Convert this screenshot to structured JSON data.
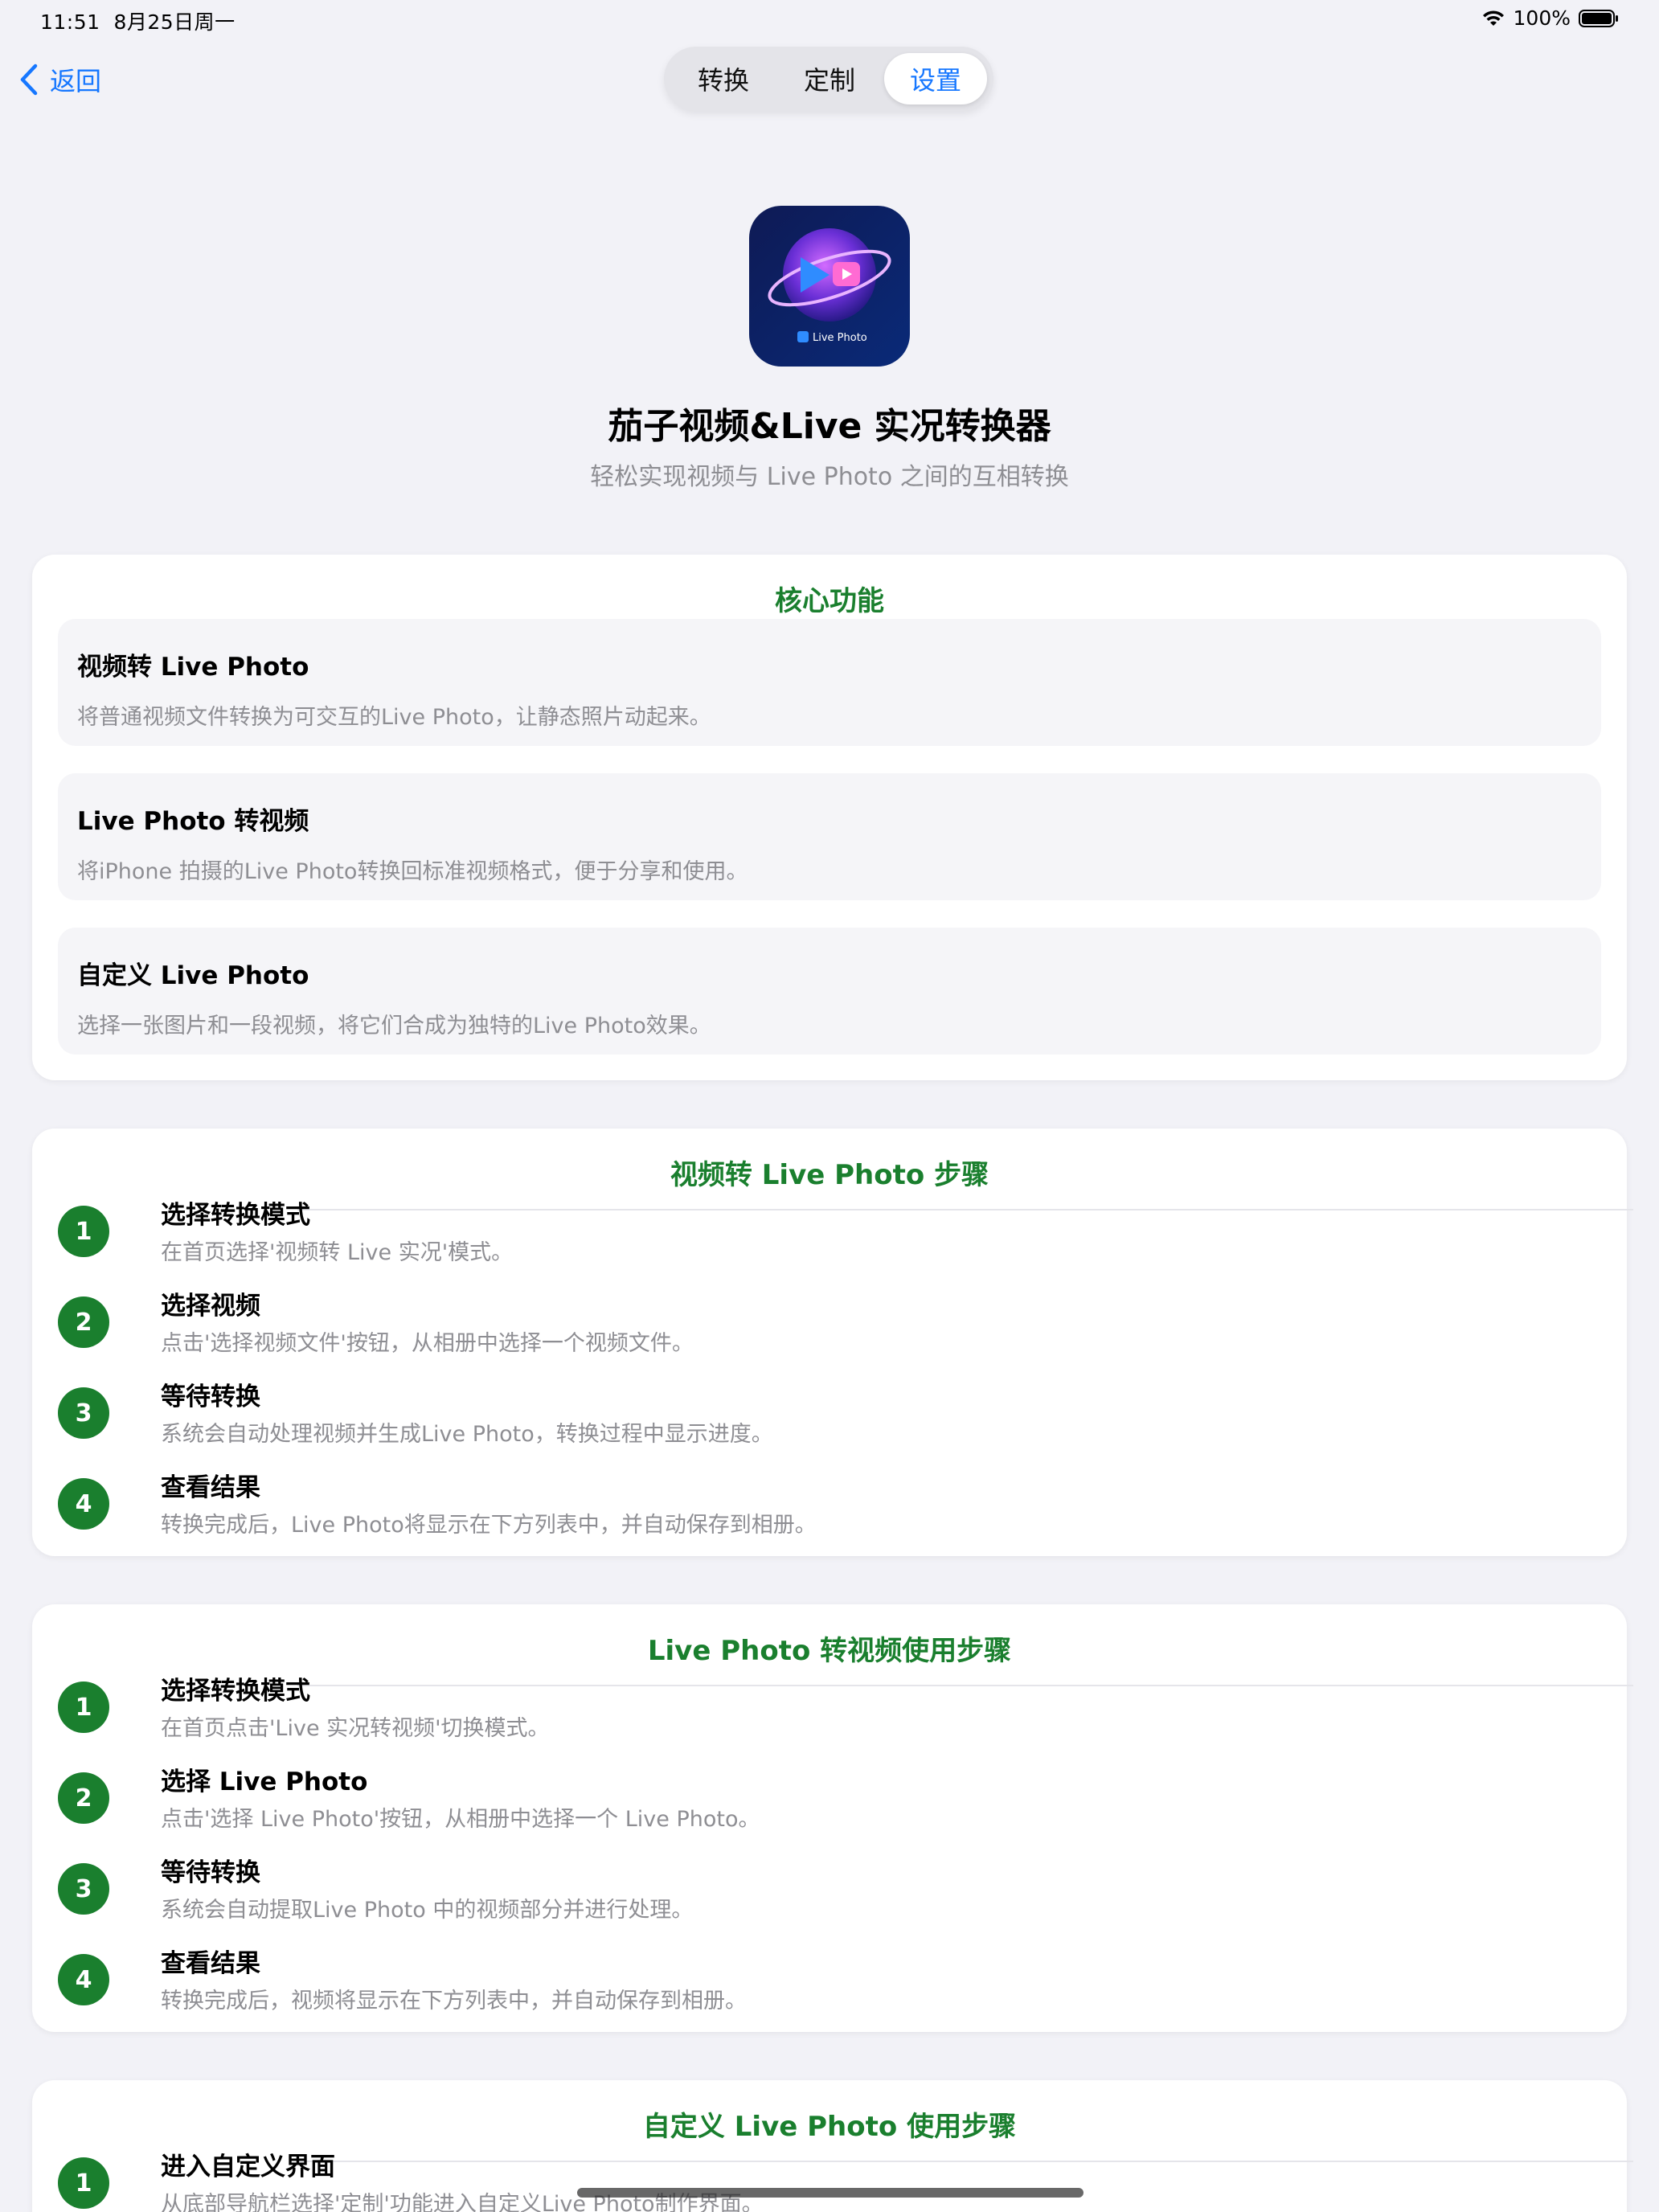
{
  "status_bar": {
    "time": "11:51",
    "date": "8月25日周一",
    "battery": "100%"
  },
  "nav": {
    "back_label": "返回",
    "tabs": [
      "转换",
      "定制",
      "设置"
    ],
    "selected_tab": "设置",
    "accent_color": "#1677ff"
  },
  "header": {
    "app_icon_label": "Live Photo",
    "app_name": "茄子视频&Live 实况转换器",
    "subtitle": "轻松实现视频与 Live Photo 之间的互相转换"
  },
  "sections": {
    "features": {
      "title": "核心功能",
      "items": [
        {
          "title": "视频转 Live Photo",
          "desc": "将普通视频文件转换为可交互的Live Photo，让静态照片动起来。"
        },
        {
          "title": "Live Photo 转视频",
          "desc": "将iPhone 拍摄的Live Photo转换回标准视频格式，便于分享和使用。"
        },
        {
          "title": "自定义 Live Photo",
          "desc": "选择一张图片和一段视频，将它们合成为独特的Live Photo效果。"
        }
      ]
    },
    "video_to_live": {
      "title": "视频转 Live Photo 步骤",
      "steps": [
        {
          "num": "1",
          "title": "选择转换模式",
          "desc": "在首页选择'视频转 Live 实况'模式。"
        },
        {
          "num": "2",
          "title": "选择视频",
          "desc": "点击'选择视频文件'按钮，从相册中选择一个视频文件。"
        },
        {
          "num": "3",
          "title": "等待转换",
          "desc": "系统会自动处理视频并生成Live Photo，转换过程中显示进度。"
        },
        {
          "num": "4",
          "title": "查看结果",
          "desc": "转换完成后，Live Photo将显示在下方列表中，并自动保存到相册。"
        }
      ]
    },
    "live_to_video": {
      "title": "Live Photo 转视频使用步骤",
      "steps": [
        {
          "num": "1",
          "title": "选择转换模式",
          "desc": "在首页点击'Live 实况转视频'切换模式。"
        },
        {
          "num": "2",
          "title": "选择 Live Photo",
          "desc": "点击'选择 Live Photo'按钮，从相册中选择一个 Live Photo。"
        },
        {
          "num": "3",
          "title": "等待转换",
          "desc": "系统会自动提取Live Photo 中的视频部分并进行处理。"
        },
        {
          "num": "4",
          "title": "查看结果",
          "desc": "转换完成后，视频将显示在下方列表中，并自动保存到相册。"
        }
      ]
    },
    "custom": {
      "title": "自定义 Live Photo 使用步骤",
      "steps": [
        {
          "num": "1",
          "title": "进入自定义界面",
          "desc": "从底部导航栏选择'定制'功能进入自定义Live Photo制作界面。"
        }
      ]
    }
  },
  "colors": {
    "section_title": "#1a7f2e",
    "step_badge": "#1a7f2e",
    "background": "#f2f2f7"
  }
}
